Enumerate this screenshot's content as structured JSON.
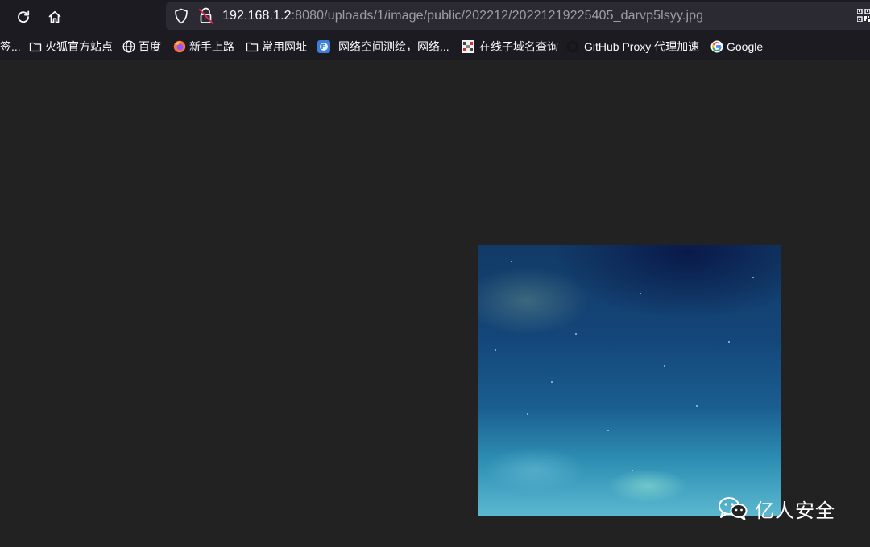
{
  "toolbar": {
    "url_host": "192.168.1.2",
    "url_rest": ":8080/uploads/1/image/public/202212/20221219225405_darvp5lsyy.jpg"
  },
  "bookmarks": [
    {
      "label": "签...",
      "icon": "none"
    },
    {
      "label": "火狐官方站点",
      "icon": "folder-icon"
    },
    {
      "label": "百度",
      "icon": "globe-icon"
    },
    {
      "label": "新手上路",
      "icon": "firefox-icon"
    },
    {
      "label": "常用网址",
      "icon": "folder-icon"
    },
    {
      "label": "网络空间测绘，网络...",
      "icon": "fofa-icon"
    },
    {
      "label": "在线子域名查询",
      "icon": "subdomain-icon"
    },
    {
      "label": "GitHub Proxy 代理加速",
      "icon": "github-icon"
    },
    {
      "label": "Google",
      "icon": "google-icon"
    }
  ],
  "watermark": {
    "text": "亿人安全",
    "icon": "wechat-icon"
  },
  "colors": {
    "chrome_bg": "#1c1b22",
    "urlbar_bg": "#2b2a33",
    "page_bg": "#222222",
    "text": "#fbfbfe"
  }
}
